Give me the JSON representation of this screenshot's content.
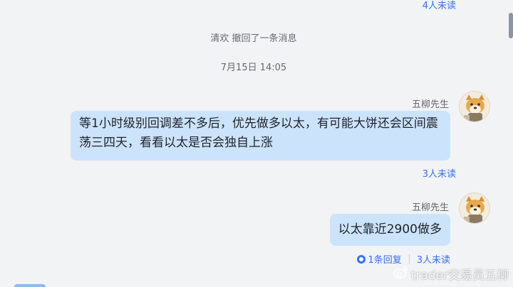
{
  "chat": {
    "top_read_status": "4人未读",
    "recall_notice": "清欢 撤回了一条消息",
    "timestamp": "7月15日 14:05",
    "messages": [
      {
        "sender": "五柳先生",
        "avatar_icon": "cartoon-dog-avatar-icon",
        "text": "等1小时级别回调差不多后，优先做多以太，有可能大饼还会区间震荡三四天，看看以太是否会独自上涨",
        "read_status": "3人未读"
      },
      {
        "sender": "五柳先生",
        "avatar_icon": "cartoon-dog-avatar-icon",
        "text": "以太靠近2900做多",
        "reply_count": "1条回复",
        "read_status": "3人未读"
      }
    ]
  },
  "watermark": {
    "text": "trader交易员五柳",
    "icon": "weibo-logo"
  },
  "colors": {
    "background": "#f2f3f5",
    "bubble": "#cce3fc",
    "accent": "#3370ff",
    "muted_text": "#646a73"
  }
}
